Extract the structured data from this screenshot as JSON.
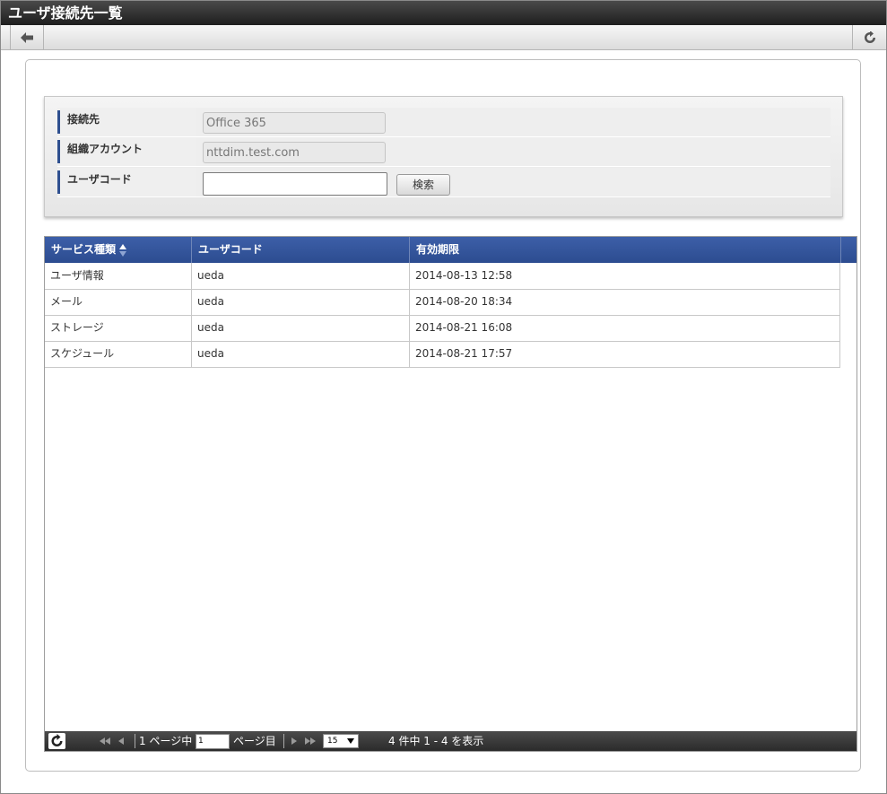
{
  "title": "ユーザ接続先一覧",
  "search": {
    "fields": [
      {
        "label": "接続先",
        "value": "Office 365"
      },
      {
        "label": "組織アカウント",
        "value": "nttdim.test.com"
      },
      {
        "label": "ユーザコード",
        "value": ""
      }
    ],
    "button": "検索"
  },
  "table": {
    "columns": [
      "サービス種類",
      "ユーザコード",
      "有効期限"
    ],
    "rows": [
      [
        "ユーザ情報",
        "ueda",
        "2014-08-13 12:58"
      ],
      [
        "メール",
        "ueda",
        "2014-08-20 18:34"
      ],
      [
        "ストレージ",
        "ueda",
        "2014-08-21 16:08"
      ],
      [
        "スケジュール",
        "ueda",
        "2014-08-21 17:57"
      ]
    ]
  },
  "pager": {
    "page_prefix": "1 ページ中",
    "page_value": "1",
    "page_suffix": "ページ目",
    "rows_per_page": "15",
    "summary": "4 件中 1 - 4 を表示"
  }
}
